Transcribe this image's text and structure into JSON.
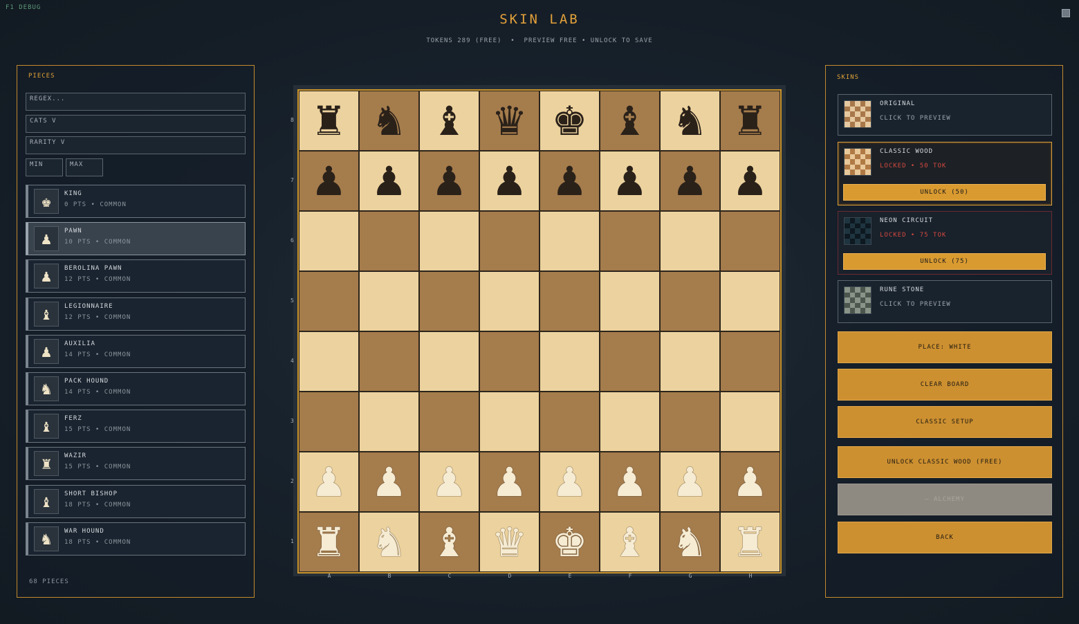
{
  "debug_label": "F1 DEBUG",
  "header": {
    "title": "SKIN LAB",
    "subtitle": "TOKENS 289 (FREE)  •  PREVIEW FREE • UNLOCK TO SAVE"
  },
  "pieces_panel": {
    "title": "PIECES",
    "search_placeholder": "REGEX...",
    "cats_label": "CATS V",
    "rarity_label": "RARITY V",
    "min_placeholder": "MIN",
    "max_placeholder": "MAX",
    "items": [
      {
        "name": "KING",
        "meta": "0 PTS • COMMON",
        "icon": "♚"
      },
      {
        "name": "PAWN",
        "meta": "10 PTS • COMMON",
        "icon": "♟"
      },
      {
        "name": "BEROLINA PAWN",
        "meta": "12 PTS • COMMON",
        "icon": "♟"
      },
      {
        "name": "LEGIONNAIRE",
        "meta": "12 PTS • COMMON",
        "icon": "♝"
      },
      {
        "name": "AUXILIA",
        "meta": "14 PTS • COMMON",
        "icon": "♟"
      },
      {
        "name": "PACK HOUND",
        "meta": "14 PTS • COMMON",
        "icon": "♞"
      },
      {
        "name": "FERZ",
        "meta": "15 PTS • COMMON",
        "icon": "♝"
      },
      {
        "name": "WAZIR",
        "meta": "15 PTS • COMMON",
        "icon": "♜"
      },
      {
        "name": "SHORT BISHOP",
        "meta": "18 PTS • COMMON",
        "icon": "♝"
      },
      {
        "name": "WAR HOUND",
        "meta": "18 PTS • COMMON",
        "icon": "♞"
      }
    ],
    "count_label": "68 PIECES"
  },
  "board": {
    "ranks": [
      "8",
      "7",
      "6",
      "5",
      "4",
      "3",
      "2",
      "1"
    ],
    "files": [
      "A",
      "B",
      "C",
      "D",
      "E",
      "F",
      "G",
      "H"
    ],
    "light_color": "#ecd29e",
    "dark_color": "#a57c4c",
    "position": [
      [
        "♜",
        "♞",
        "♝",
        "♛",
        "♚",
        "♝",
        "♞",
        "♜"
      ],
      [
        "♟",
        "♟",
        "♟",
        "♟",
        "♟",
        "♟",
        "♟",
        "♟"
      ],
      [
        "",
        "",
        "",
        "",
        "",
        "",
        "",
        ""
      ],
      [
        "",
        "",
        "",
        "",
        "",
        "",
        "",
        ""
      ],
      [
        "",
        "",
        "",
        "",
        "",
        "",
        "",
        ""
      ],
      [
        "",
        "",
        "",
        "",
        "",
        "",
        "",
        ""
      ],
      [
        "♟",
        "♟",
        "♟",
        "♟",
        "♟",
        "♟",
        "♟",
        "♟"
      ],
      [
        "♜",
        "♞",
        "♝",
        "♛",
        "♚",
        "♝",
        "♞",
        "♜"
      ]
    ]
  },
  "skins_panel": {
    "title": "SKINS",
    "skins": [
      {
        "name": "ORIGINAL",
        "status": "CLICK TO PREVIEW",
        "light": "#e6c9a0",
        "dark": "#a8784a"
      },
      {
        "name": "CLASSIC WOOD",
        "status": "LOCKED • 50 TOK",
        "unlock": "UNLOCK (50)",
        "light": "#e9c89a",
        "dark": "#b07a45"
      },
      {
        "name": "NEON CIRCUIT",
        "status": "LOCKED • 75 TOK",
        "unlock": "UNLOCK (75)",
        "light": "#1e3540",
        "dark": "#0e1820"
      },
      {
        "name": "RUNE STONE",
        "status": "CLICK TO PREVIEW",
        "light": "#8a9488",
        "dark": "#4c564e"
      }
    ],
    "actions": {
      "place": "PLACE: WHITE",
      "clear": "CLEAR BOARD",
      "classic": "CLASSIC SETUP",
      "unlock_free": "UNLOCK CLASSIC WOOD (FREE)",
      "disabled": "— ALCHEMY",
      "back": "BACK"
    }
  }
}
